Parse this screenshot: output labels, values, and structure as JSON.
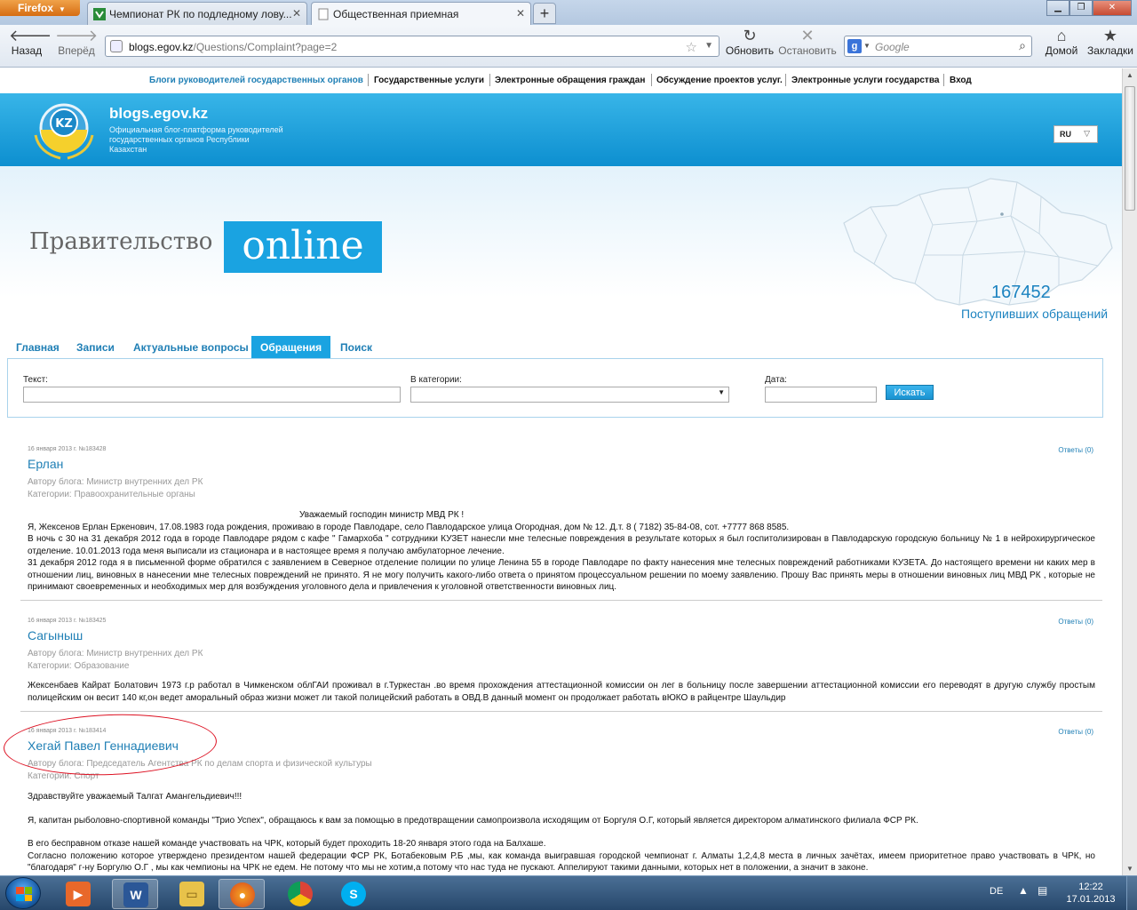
{
  "browser": {
    "menu_label": "Firefox",
    "tabs": [
      {
        "title": "Чемпионат РК по подледному лову..."
      },
      {
        "title": "Общественная приемная"
      }
    ],
    "nav": {
      "back": "Назад",
      "forward": "Вперёд",
      "reload": "Обновить",
      "stop": "Остановить",
      "home": "Домой",
      "bookmarks": "Закладки"
    },
    "url_host": "blogs.egov.kz",
    "url_path": "/Questions/Complaint?page=2",
    "search_placeholder": "Google"
  },
  "topnav": [
    "Блоги руководителей государственных органов",
    "Государственные услуги",
    "Электронные обращения граждан",
    "Обсуждение проектов услуг.",
    "Электронные услуги государства",
    "Вход"
  ],
  "header": {
    "site_title": "blogs.egov.kz",
    "subtitle": "Официальная блог-платформа руководителей государственных органов Республики Казахстан",
    "lang": "RU"
  },
  "banner": {
    "gov": "Правительство",
    "online": "online",
    "count": "167452",
    "count_label": "Поступивших обращений"
  },
  "tabs": [
    "Главная",
    "Записи",
    "Актуальные вопросы",
    "Обращения",
    "Поиск"
  ],
  "filter": {
    "text_label": "Текст:",
    "category_label": "В категории:",
    "date_label": "Дата:",
    "search_button": "Искать"
  },
  "posts": [
    {
      "meta": "16 января 2013 г. №183428",
      "reply": "Ответы (0)",
      "name": "Ерлан",
      "blog": "Автору блога: Министр внутренних дел РК",
      "category": "Категории: Правоохранительные органы",
      "greeting": "Уважаемый господин министр МВД РК !",
      "paragraphs": [
        "Я, Жексенов Ерлан Еркенович, 17.08.1983 года рождения, проживаю в городе Павлодаре, село Павлодарское улица Огородная, дом № 12. Д.т. 8 ( 7182) 35-84-08, сот. +7777 868 8585.",
        "В ночь с 30 на 31 декабря 2012 года в городе Павлодаре рядом с кафе \" Гамархоба \" сотрудники КУЗЕТ нанесли мне телесные повреждения в результате которых я был госпитолизирован в Павлодарскую городскую больницу № 1 в нейрохирургическое отделение. 10.01.2013 года меня выписали из стационара и в настоящее время я получаю амбулаторное лечение.",
        "31 декабря 2012 года я в письменной форме обратился с заявлением в Северное отделение полиции по улице Ленина 55 в городе Павлодаре по факту нанесения мне телесных повреждений работниками КУЗЕТА. До настоящего времени ни каких мер в отношении лиц, виновных в нанесении мне телесных повреждений не принято. Я не могу получить какого-либо ответа о принятом процессуальном решении по моему заявлению.  Прошу Вас принять меры в отношении виновных лиц МВД РК , которые не принимают своевременных и необходимых мер для возбуждения уголовного дела и привлечения к уголовной ответственности виновных лиц."
      ]
    },
    {
      "meta": "16 января 2013 г. №183425",
      "reply": "Ответы (0)",
      "name": "Сагыныш",
      "blog": "Автору блога: Министр внутренних дел РК",
      "category": "Категории: Образование",
      "paragraphs": [
        "Жексенбаев Кайрат Болатович 1973 г.р работал в Чимкенском облГАИ проживал в г.Туркестан .во время прохождения аттестационной комиссии он лег в больницу после завершении аттестационной комиссии его переводят в другую службу простым полицейским он весит 140 кг,он ведет аморальный образ жизни может ли такой полицейский работать в ОВД.В данный момент он продолжает работать вЮКО в райцентре Шаульдир"
      ]
    },
    {
      "meta": "16 января 2013 г. №183414",
      "reply": "Ответы (0)",
      "name": "Хегай Павел Геннадиевич",
      "blog": "Автору блога: Председатель Агентства РК по делам спорта и физической культуры",
      "category": "Категории: Спорт",
      "paragraphs": [
        "Здравствуйте уважаемый Талгат Амангельдиевич!!!",
        "Я, капитан рыболовно-спортивной команды  \"Трио Успех\", обращаюсь к вам за помощью в предотвращении самопроизвола исходящим от Боргуля О.Г, который является директором алматинского филиала ФСР РК.",
        " В его бесправном отказе нашей команде участвовать  на ЧРК, который будет проходить 18-20 января этого года на Балхаше.",
        " Согласно положению которое утверждено президентом нашей федерации ФСР РК, Ботабековым Р.Б ,мы, как команда выигравшая городской чемпионат г. Алматы  1,2,4,8 места в личных зачётах, имеем приоритетное право участвовать в ЧРК, но \"благодаря\" г-ну Боргулю О.Г , мы как чемпионы на ЧРК не едем. Не потому что мы не хотим,а потому что нас туда не пускают. Аппелируют такими данными, которых нет в положении, а значит в законе."
      ]
    }
  ],
  "taskbar": {
    "lang": "DE",
    "time": "12:22",
    "date": "17.01.2013"
  }
}
